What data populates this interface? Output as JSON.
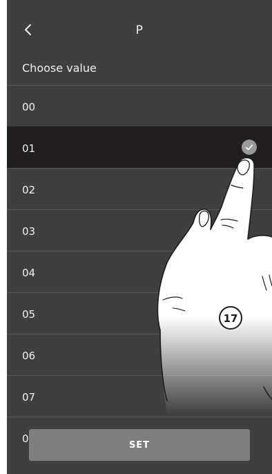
{
  "header": {
    "title": "P",
    "back_icon": "chevron-left-icon"
  },
  "subtitle": "Choose value",
  "options": [
    {
      "label": "00"
    },
    {
      "label": "01",
      "selected": true
    },
    {
      "label": "02"
    },
    {
      "label": "03"
    },
    {
      "label": "04"
    },
    {
      "label": "05"
    },
    {
      "label": "06"
    },
    {
      "label": "07"
    },
    {
      "label": "08"
    }
  ],
  "selected_icon": "checkmark-icon",
  "set_button": {
    "label": "SET"
  },
  "callout": {
    "number": "17"
  },
  "colors": {
    "background": "#3f3f3f",
    "selected_row": "#201e1e",
    "divider": "#5a5a5a",
    "button": "#7e7e7e"
  }
}
